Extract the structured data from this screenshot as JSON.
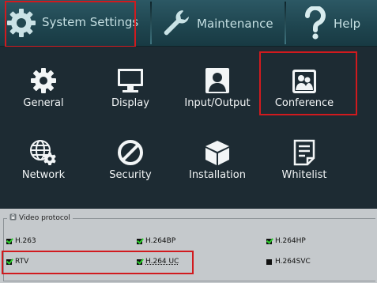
{
  "topbar": {
    "tabs": [
      {
        "label": "System Settings",
        "icon": "gear-icon",
        "active": true
      },
      {
        "label": "Maintenance",
        "icon": "wrench-icon"
      },
      {
        "label": "Help",
        "icon": "question-icon"
      }
    ]
  },
  "grid": {
    "items": [
      {
        "label": "General",
        "icon": "gear-icon"
      },
      {
        "label": "Display",
        "icon": "monitor-icon"
      },
      {
        "label": "Input/Output",
        "icon": "person-icon"
      },
      {
        "label": "Conference",
        "icon": "picture-icon"
      },
      {
        "label": "Network",
        "icon": "globe-gear-icon"
      },
      {
        "label": "Security",
        "icon": "no-entry-icon"
      },
      {
        "label": "Installation",
        "icon": "box-icon"
      },
      {
        "label": "Whitelist",
        "icon": "document-icon"
      }
    ]
  },
  "video_protocol": {
    "title": "Video protocol",
    "options": [
      {
        "label": "H.263",
        "checked": true
      },
      {
        "label": "H.264BP",
        "checked": true
      },
      {
        "label": "H.264HP",
        "checked": true
      },
      {
        "label": "RTV",
        "checked": true
      },
      {
        "label": "H.264 UC",
        "checked": true
      },
      {
        "label": "H.264SVC",
        "checked": false
      }
    ]
  },
  "colors": {
    "highlight": "#d11a1e",
    "check": "#2fd12f",
    "background": "#1d2b33"
  }
}
